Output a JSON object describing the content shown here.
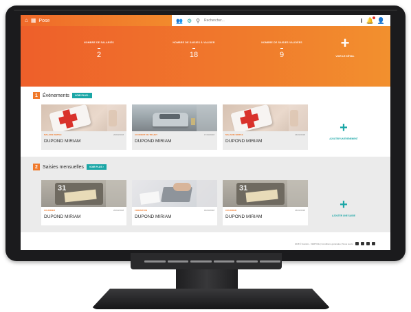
{
  "topbar": {
    "brand": "Pose",
    "home_icon": "home-icon",
    "apps_icon": "grid-icon",
    "search_placeholder": "Rechercher..."
  },
  "hero": {
    "stats": [
      {
        "label": "Nombre de salariés",
        "value": "2"
      },
      {
        "label": "Nombre de saisies à valider",
        "value": "18"
      },
      {
        "label": "Nombre de saisies validées",
        "value": "9"
      }
    ],
    "add_label": "Voir le détail"
  },
  "events": {
    "number": "1",
    "title": "Événements",
    "more_label": "Voir plus",
    "cards": [
      {
        "category": "Maladie simple",
        "date": "20/03/2018",
        "name": "DUPOND MIRIAM"
      },
      {
        "category": "Accident de trajet",
        "date": "17/03/2018",
        "name": "DUPOND MIRIAM"
      },
      {
        "category": "Maladie simple",
        "date": "16/03/2018",
        "name": "DUPOND MIRIAM"
      }
    ],
    "add_label": "Ajouter un événement"
  },
  "saisies": {
    "number": "2",
    "title": "Saisies mensuelles",
    "more_label": "Voir plus",
    "cards": [
      {
        "category": "Courrier",
        "date": "20/03/2018",
        "name": "DUPOND MIRIAM"
      },
      {
        "category": "Formation",
        "date": "18/03/2018",
        "name": "DUPOND MIRIAM"
      },
      {
        "category": "Courrier",
        "date": "16/03/2018",
        "name": "DUPOND MIRIAM"
      }
    ],
    "add_label": "Ajouter une saisie"
  },
  "footer": {
    "text": "2018 © Assistic - VERTICE | Conditions générales | Nous suivre"
  },
  "colors": {
    "brand_orange": "#f07a2c",
    "accent_teal": "#1aa6a6",
    "bezel": "#1b1b1d"
  }
}
